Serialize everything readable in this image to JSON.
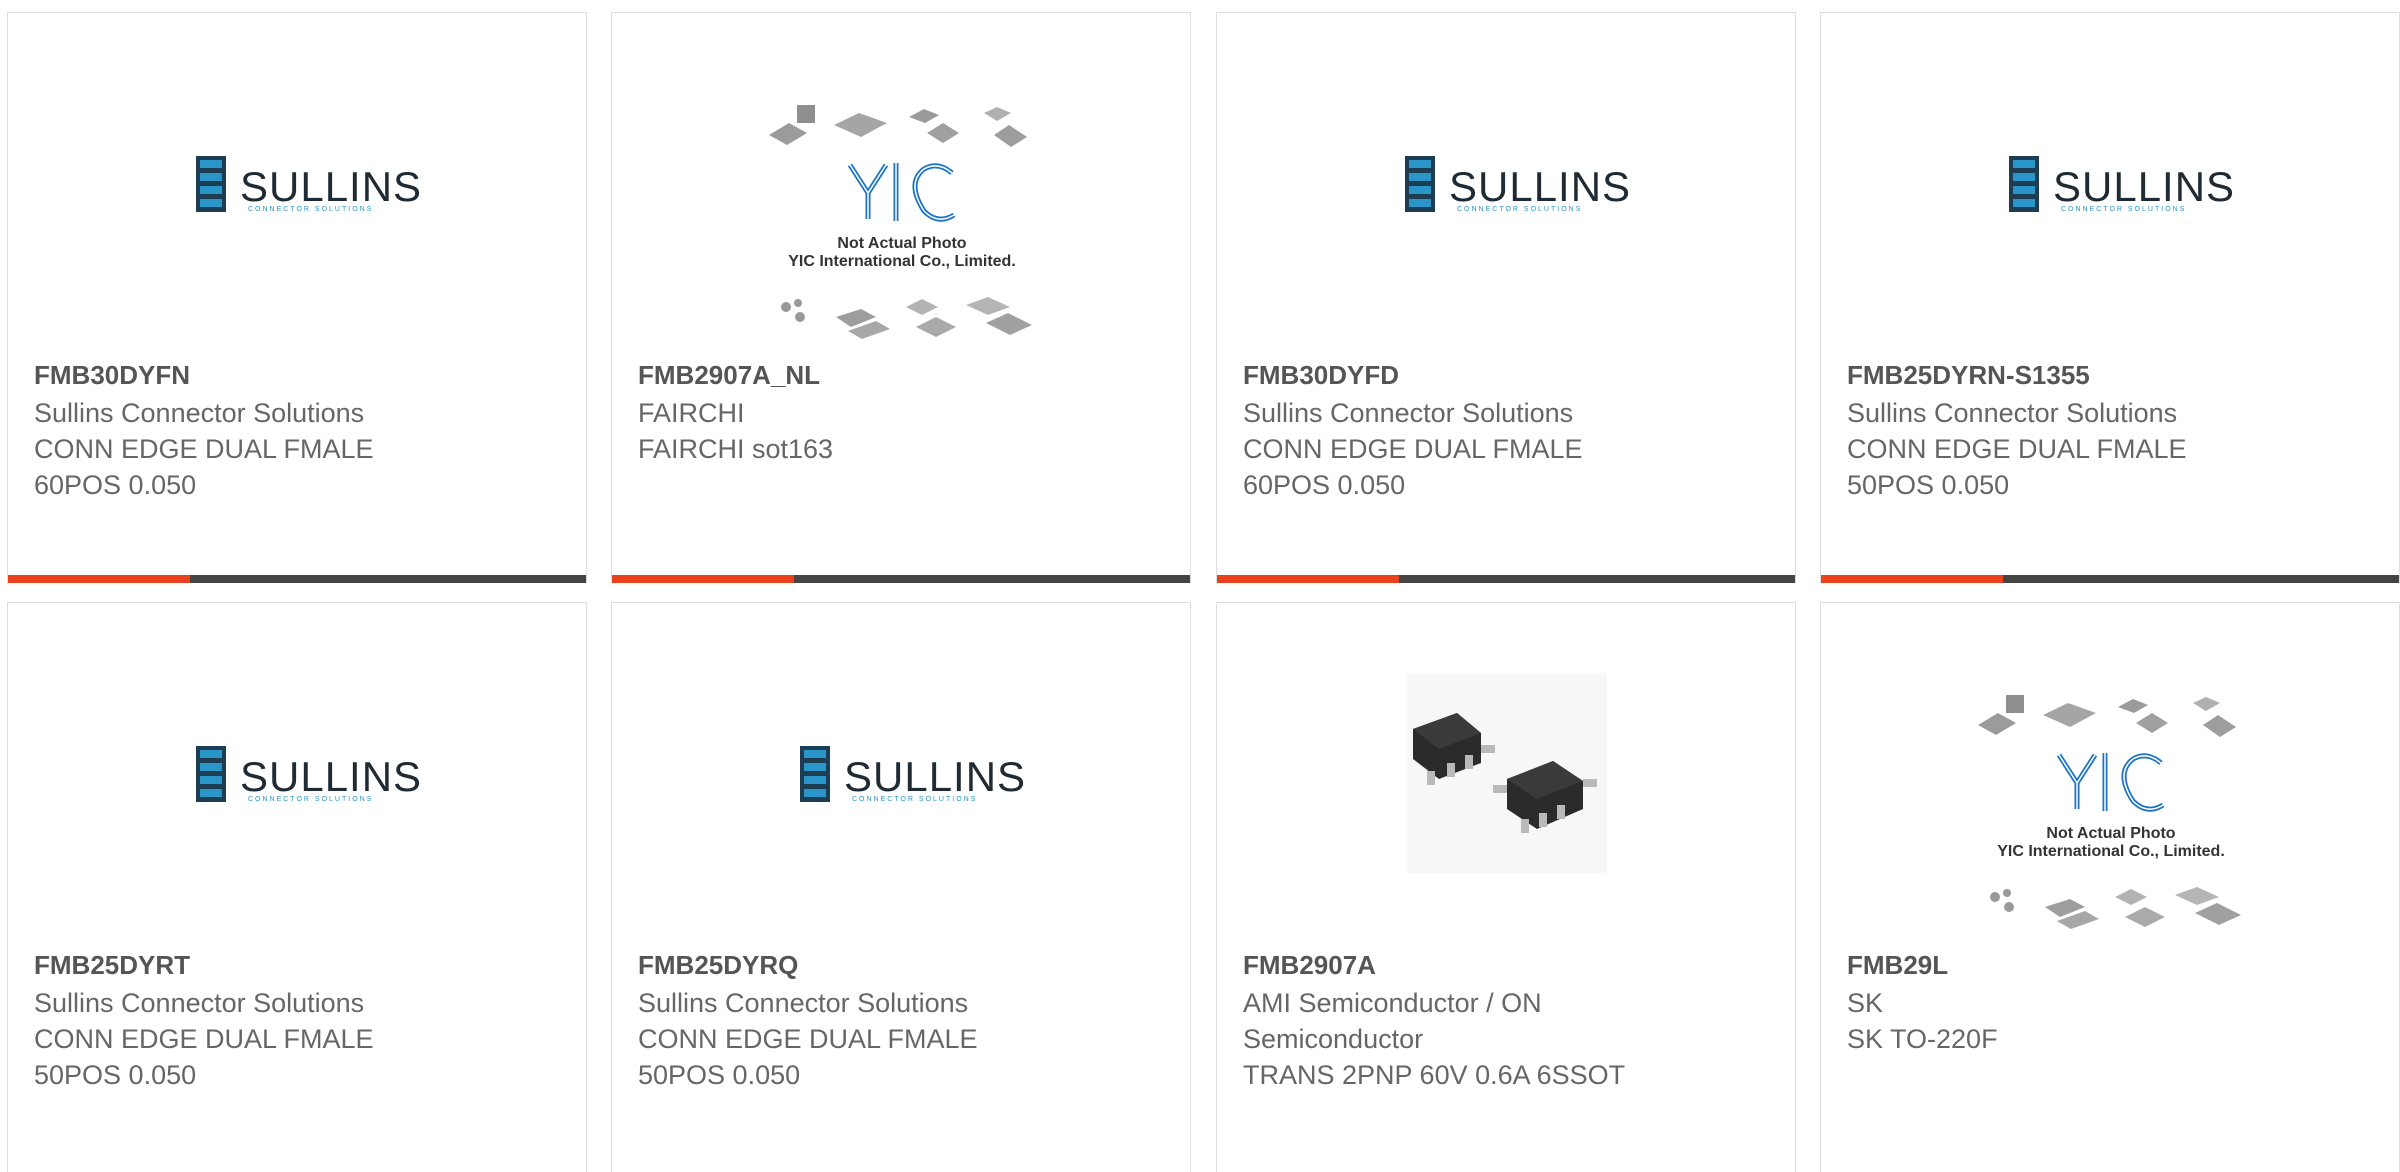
{
  "products": [
    {
      "part_number": "FMB30DYFN",
      "manufacturer": "Sullins Connector Solutions",
      "description_line1": "CONN EDGE DUAL FMALE",
      "description_line2": "60POS 0.050",
      "image": "sullins-logo"
    },
    {
      "part_number": "FMB2907A_NL",
      "manufacturer": "FAIRCHI",
      "description_line1": "FAIRCHI sot163",
      "description_line2": "",
      "image": "yic-placeholder"
    },
    {
      "part_number": "FMB30DYFD",
      "manufacturer": "Sullins Connector Solutions",
      "description_line1": "CONN EDGE DUAL FMALE",
      "description_line2": "60POS 0.050",
      "image": "sullins-logo"
    },
    {
      "part_number": "FMB25DYRN-S1355",
      "manufacturer": "Sullins Connector Solutions",
      "description_line1": "CONN EDGE DUAL FMALE",
      "description_line2": "50POS 0.050",
      "image": "sullins-logo"
    },
    {
      "part_number": "FMB25DYRT",
      "manufacturer": "Sullins Connector Solutions",
      "description_line1": "CONN EDGE DUAL FMALE",
      "description_line2": "50POS 0.050",
      "image": "sullins-logo"
    },
    {
      "part_number": "FMB25DYRQ",
      "manufacturer": "Sullins Connector Solutions",
      "description_line1": "CONN EDGE DUAL FMALE",
      "description_line2": "50POS 0.050",
      "image": "sullins-logo"
    },
    {
      "part_number": "FMB2907A",
      "manufacturer": "AMI Semiconductor / ON",
      "description_line1": "Semiconductor",
      "description_line2": "TRANS 2PNP 60V 0.6A 6SSOT",
      "image": "sot-chip-photo"
    },
    {
      "part_number": "FMB29L",
      "manufacturer": "SK",
      "description_line1": "SK TO-220F",
      "description_line2": "",
      "image": "yic-placeholder"
    }
  ],
  "logo": {
    "sullins_name": "SULLINS",
    "sullins_tagline": "CONNECTOR SOLUTIONS"
  },
  "placeholder": {
    "brand": "YIC",
    "line1": "Not Actual Photo",
    "line2": "YIC International Co., Limited."
  },
  "colors": {
    "accent": "#e8411c",
    "bar": "#444444",
    "text": "#666666",
    "part_number": "#555555",
    "sullins_blue": "#1e87b5",
    "yic_blue": "#1b74c6"
  }
}
